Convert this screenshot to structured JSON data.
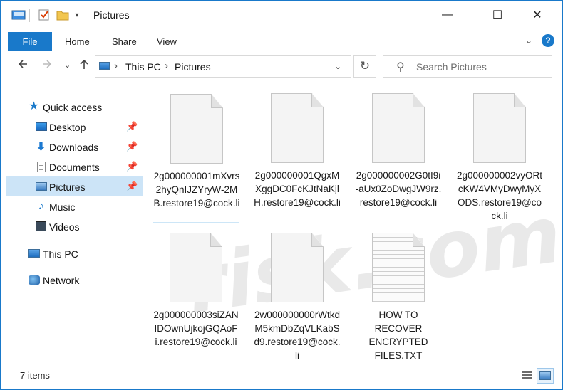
{
  "window": {
    "title": "Pictures",
    "minimize": "—",
    "maximize": "☐",
    "close": "✕"
  },
  "ribbon": {
    "tabs": [
      "File",
      "Home",
      "Share",
      "View"
    ],
    "help": "?"
  },
  "address": {
    "crumbs": [
      "This PC",
      "Pictures"
    ],
    "search_placeholder": "Search Pictures"
  },
  "nav": {
    "quick_access": "Quick access",
    "items": [
      {
        "label": "Desktop",
        "pinned": true
      },
      {
        "label": "Downloads",
        "pinned": true
      },
      {
        "label": "Documents",
        "pinned": true
      },
      {
        "label": "Pictures",
        "pinned": true,
        "selected": true
      },
      {
        "label": "Music",
        "pinned": false
      },
      {
        "label": "Videos",
        "pinned": false
      }
    ],
    "this_pc": "This PC",
    "network": "Network"
  },
  "files": [
    {
      "name": "2g000000001mXvrs2hyQnIJZYryW-2MB.restore19@cock.li",
      "icon": "file-icon"
    },
    {
      "name": "2g000000001QgxMXggDC0FcKJtNaKjlH.restore19@cock.li",
      "icon": "file-icon"
    },
    {
      "name": "2g000000002G0tI9i-aUx0ZoDwgJW9rz.restore19@cock.li",
      "icon": "file-icon"
    },
    {
      "name": "2g000000002vyORtcKW4VMyDwyMyXODS.restore19@cock.li",
      "icon": "file-icon"
    },
    {
      "name": "2g000000003siZANIDOwnUjkojGQAoFi.restore19@cock.li",
      "icon": "file-icon"
    },
    {
      "name": "2w000000000rWtkdM5kmDbZqVLKabSd9.restore19@cock.li",
      "icon": "file-icon"
    },
    {
      "name": "HOW TO RECOVER ENCRYPTED FILES.TXT",
      "icon": "text-file-icon"
    }
  ],
  "status": {
    "item_count": "7 items"
  },
  "watermark": {
    "text": "risk.com"
  },
  "colors": {
    "accent": "#1979ca",
    "selected_bg": "#cce4f7"
  }
}
